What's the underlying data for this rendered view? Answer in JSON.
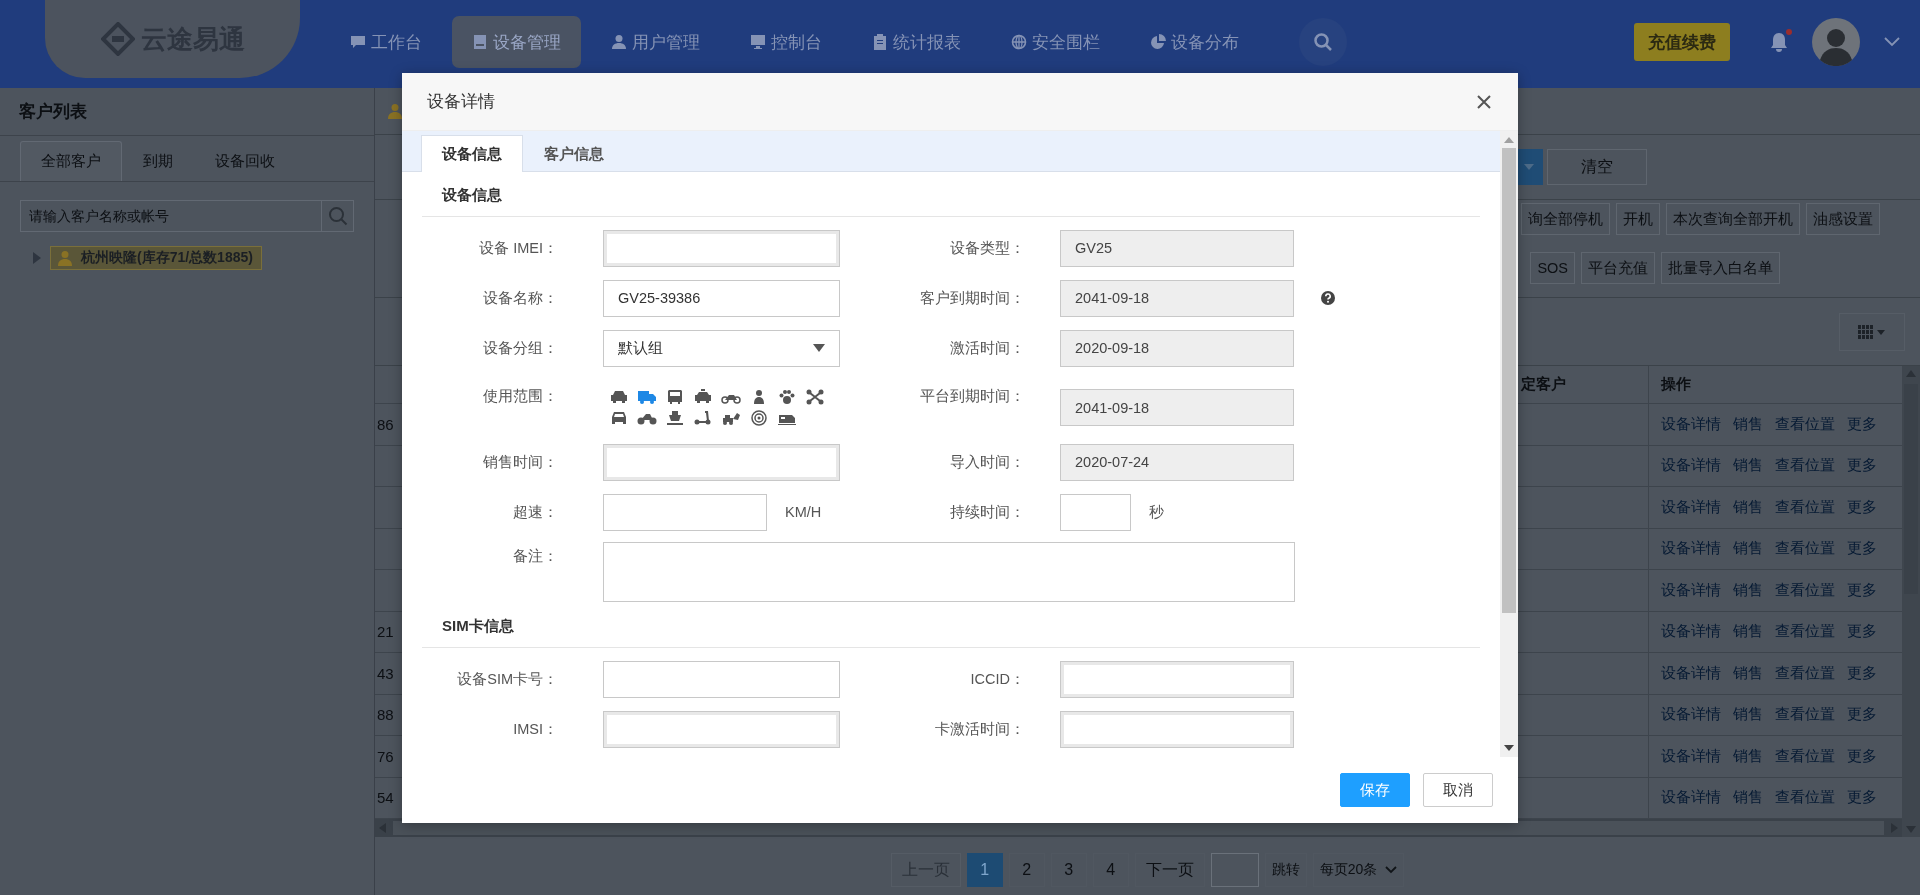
{
  "nav": {
    "logo": "云途易通",
    "items": [
      {
        "label": "工作台",
        "selected": false
      },
      {
        "label": "设备管理",
        "selected": true
      },
      {
        "label": "用户管理",
        "selected": false
      },
      {
        "label": "控制台",
        "selected": false
      },
      {
        "label": "统计报表",
        "selected": false
      },
      {
        "label": "安全围栏",
        "selected": false
      },
      {
        "label": "设备分布",
        "selected": false
      }
    ],
    "recharge": "充值续费",
    "unread": true
  },
  "sidebar": {
    "title": "客户列表",
    "tabs": [
      {
        "label": "全部客户",
        "selected": true
      },
      {
        "label": "到期",
        "selected": false
      },
      {
        "label": "设备回收",
        "selected": false
      }
    ],
    "search": {
      "placeholder": "请输入客户名称或帐号"
    },
    "tree": [
      {
        "label": "杭州映隆(库存71/总数1885)",
        "expanded": false,
        "selected": true
      }
    ]
  },
  "toolbar": {
    "clear": "清空",
    "actions": [
      [
        "询全部停机",
        "开机",
        "本次查询全部开机",
        "油感设置"
      ],
      [
        "SOS",
        "平台充值",
        "批量导入白名单"
      ]
    ]
  },
  "table": {
    "columns": [
      "定客户",
      "操作"
    ],
    "rows": [
      {
        "column_1": "86",
        "actions": [
          "设备详情",
          "销售",
          "查看位置",
          "更多"
        ]
      },
      {
        "actions": [
          "设备详情",
          "销售",
          "查看位置",
          "更多"
        ]
      },
      {
        "actions": [
          "设备详情",
          "销售",
          "查看位置",
          "更多"
        ]
      },
      {
        "actions": [
          "设备详情",
          "销售",
          "查看位置",
          "更多"
        ]
      },
      {
        "actions": [
          "设备详情",
          "销售",
          "查看位置",
          "更多"
        ]
      },
      {
        "column_1": "21",
        "actions": [
          "设备详情",
          "销售",
          "查看位置",
          "更多"
        ]
      },
      {
        "column_1": "43",
        "actions": [
          "设备详情",
          "销售",
          "查看位置",
          "更多"
        ]
      },
      {
        "column_1": "88",
        "actions": [
          "设备详情",
          "销售",
          "查看位置",
          "更多"
        ]
      },
      {
        "column_1": "76",
        "actions": [
          "设备详情",
          "销售",
          "查看位置",
          "更多"
        ]
      },
      {
        "column_1": "54",
        "actions": [
          "设备详情",
          "销售",
          "查看位置",
          "更多"
        ]
      }
    ]
  },
  "pagination": {
    "prev": {
      "label": "上一页",
      "disabled": true
    },
    "pages": [
      {
        "label": "1",
        "selected": true
      },
      {
        "label": "2",
        "selected": false
      },
      {
        "label": "3",
        "selected": false
      },
      {
        "label": "4",
        "selected": false
      }
    ],
    "next": {
      "label": "下一页",
      "disabled": false
    },
    "jump": "跳转",
    "page_size": "每页20条"
  },
  "dialog": {
    "title": "设备详情",
    "tabs": [
      {
        "label": "设备信息",
        "selected": true
      },
      {
        "label": "客户信息",
        "selected": false
      }
    ],
    "sections": [
      {
        "title": "设备信息",
        "rows": [
          {
            "left": {
              "label": "设备 IMEI：",
              "kind": "inset"
            },
            "right": {
              "label": "设备类型：",
              "kind": "readonly",
              "value": "GV25"
            }
          },
          {
            "left": {
              "label": "设备名称：",
              "kind": "input",
              "value": "GV25-39386"
            },
            "right": {
              "label": "客户到期时间：",
              "kind": "readonly",
              "value": "2041-09-18",
              "help": true
            }
          },
          {
            "left": {
              "label": "设备分组：",
              "kind": "select",
              "value": "默认组"
            },
            "right": {
              "label": "激活时间：",
              "kind": "readonly",
              "value": "2020-09-18"
            }
          },
          {
            "left": {
              "label": "使用范围：",
              "kind": "icons",
              "icons": [
                {
                  "selected": false
                },
                {
                  "selected": true
                },
                {
                  "selected": false
                },
                {
                  "selected": false
                },
                {
                  "selected": false
                },
                {
                  "selected": false
                },
                {
                  "selected": false
                },
                {
                  "selected": false
                },
                {
                  "selected": false
                },
                {
                  "selected": false
                },
                {
                  "selected": false
                },
                {
                  "selected": false
                },
                {
                  "selected": false
                },
                {
                  "selected": false
                },
                {
                  "selected": false
                }
              ]
            },
            "right": {
              "label": "平台到期时间：",
              "kind": "readonly",
              "value": "2041-09-18"
            }
          },
          {
            "left": {
              "label": "销售时间：",
              "kind": "inset"
            },
            "right": {
              "label": "导入时间：",
              "kind": "readonly",
              "value": "2020-07-24"
            }
          },
          {
            "left": {
              "label": "超速：",
              "kind": "short",
              "unit": "KM/H"
            },
            "right": {
              "label": "持续时间：",
              "kind": "tiny",
              "unit": "秒"
            }
          },
          {
            "wide": {
              "label": "备注：",
              "kind": "textarea"
            }
          }
        ]
      },
      {
        "title": "SIM卡信息",
        "rows": [
          {
            "left": {
              "label": "设备SIM卡号：",
              "kind": "input"
            },
            "right": {
              "label": "ICCID：",
              "kind": "inset"
            }
          },
          {
            "left": {
              "label": "IMSI：",
              "kind": "inset"
            },
            "right": {
              "label": "卡激活时间：",
              "kind": "inset"
            }
          }
        ]
      }
    ],
    "buttons": [
      {
        "label": "保存",
        "kind": "primary"
      },
      {
        "label": "取消",
        "kind": "default"
      }
    ]
  }
}
